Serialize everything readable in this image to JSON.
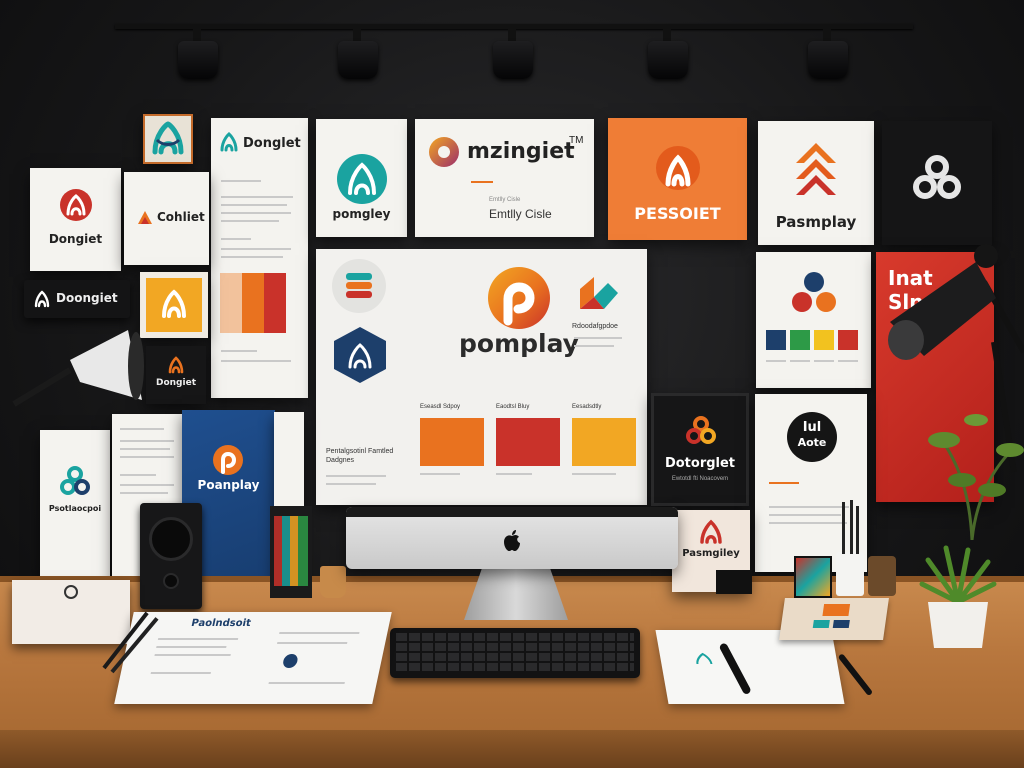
{
  "wall": {
    "card_a": {
      "wordmark": "Donglet"
    },
    "card_b": {
      "wordmark": "Cohliet"
    },
    "card_c": {
      "wordmark": "Dongiet"
    },
    "dark_pill": {
      "wordmark": "Doongiet"
    },
    "dark_square_left": {
      "wordmark": "Dongiet"
    },
    "mzingiet": {
      "wordmark": "mzingiet",
      "tm": "TM",
      "sub_small": "Emtlly Cisle",
      "sub": "Emtlly Cisle"
    },
    "pomgley": {
      "wordmark": "pomgley"
    },
    "orange_card": {
      "wordmark": "PESSOIET"
    },
    "pasmplay": {
      "wordmark": "Pasmplay"
    },
    "big_board": {
      "wordmark": "pomplay",
      "bottom_caption": "Pentalgsotinl Famtled Dadgnes",
      "swatch_labels": [
        "Eseasdl Sdpoy",
        "Eaodtsl Bluy",
        "Eesadsdtly"
      ],
      "right_caption": "Rdoodafgpdoe"
    },
    "dortorglet": {
      "wordmark": "Dotorglet",
      "caption": "Ewtotdl fti Noacovem"
    },
    "circle_card": {
      "line1": "Iul",
      "line2": "Aote"
    },
    "red_poster": {
      "word1": "Inat",
      "word2": "Slnc"
    },
    "blue_book": {
      "wordmark": "Poanplay"
    },
    "left_paper": {
      "wordmark": "Psotlaocpoi"
    },
    "desk_card": {
      "wordmark": "Pasmgiley"
    }
  },
  "desk": {
    "doc_left": {
      "title": "Paolndsoit"
    }
  },
  "colors": {
    "orange": "#e9721f",
    "red": "#c9322a",
    "yellow": "#f2a723",
    "teal": "#1aa3a0",
    "navy": "#1d3f6b",
    "wood": "#b8773e",
    "wall": "#1b1b1c"
  }
}
